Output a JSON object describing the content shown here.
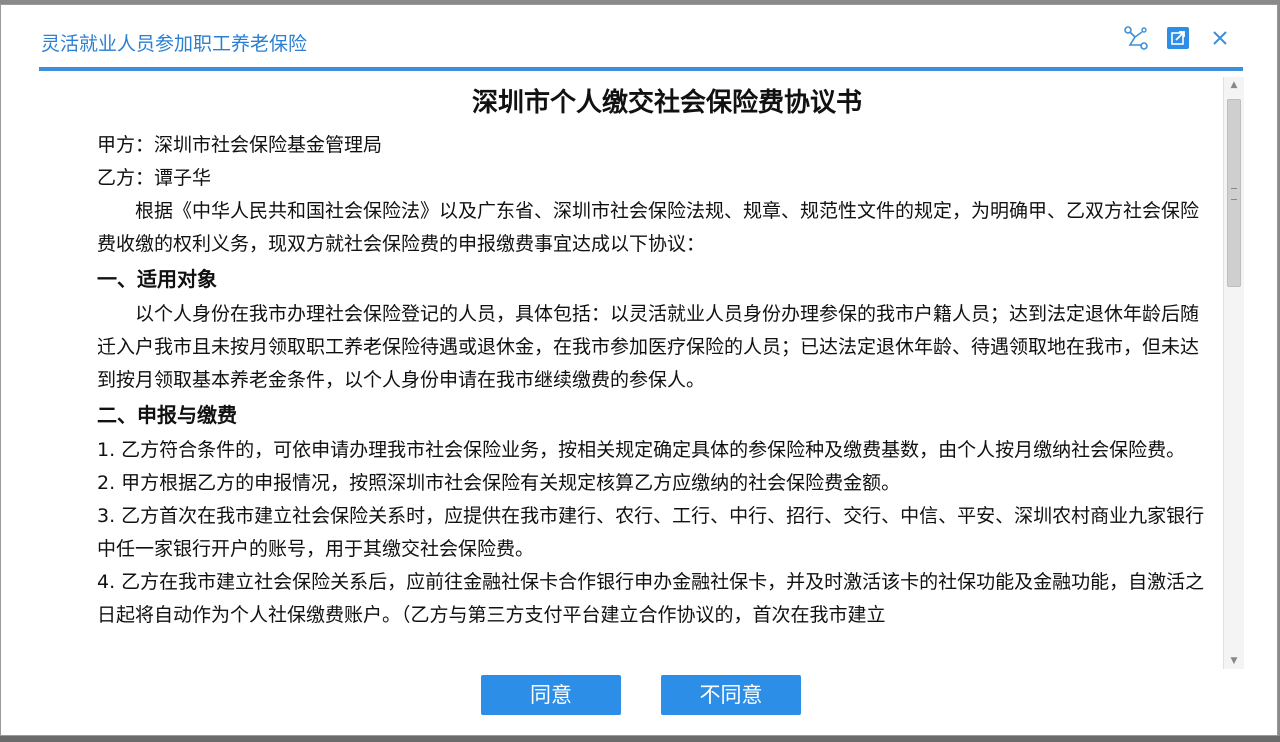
{
  "window": {
    "title": "灵活就业人员参加职工养老保险",
    "icons": [
      "connect-icon",
      "popout-icon",
      "close-icon"
    ]
  },
  "document": {
    "title": "深圳市个人缴交社会保险费协议书",
    "party_a": "甲方：深圳市社会保险基金管理局",
    "party_b": "乙方：谭子华",
    "intro": "根据《中华人民共和国社会保险法》以及广东省、深圳市社会保险法规、规章、规范性文件的规定，为明确甲、乙双方社会保险费收缴的权利义务，现双方就社会保险费的申报缴费事宜达成以下协议：",
    "section1_title": "一、适用对象",
    "section1_body": "以个人身份在我市办理社会保险登记的人员，具体包括：以灵活就业人员身份办理参保的我市户籍人员；达到法定退休年龄后随迁入户我市且未按月领取职工养老保险待遇或退休金，在我市参加医疗保险的人员；已达法定退休年龄、待遇领取地在我市，但未达到按月领取基本养老金条件，以个人身份申请在我市继续缴费的参保人。",
    "section2_title": "二、申报与缴费",
    "items": [
      "1. 乙方符合条件的，可依申请办理我市社会保险业务，按相关规定确定具体的参保险种及缴费基数，由个人按月缴纳社会保险费。",
      "2. 甲方根据乙方的申报情况，按照深圳市社会保险有关规定核算乙方应缴纳的社会保险费金额。",
      "3. 乙方首次在我市建立社会保险关系时，应提供在我市建行、农行、工行、中行、招行、交行、中信、平安、深圳农村商业九家银行中任一家银行开户的账号，用于其缴交社会保险费。",
      "4. 乙方在我市建立社会保险关系后，应前往金融社保卡合作银行申办金融社保卡，并及时激活该卡的社保功能及金融功能，自激活之日起将自动作为个人社保缴费账户。（乙方与第三方支付平台建立合作协议的，首次在我市建立"
    ]
  },
  "buttons": {
    "agree": "同意",
    "disagree": "不同意"
  },
  "colors": {
    "accent": "#2d8ee8",
    "title_text": "#2a7fd4",
    "rule": "#3d8fd9"
  }
}
